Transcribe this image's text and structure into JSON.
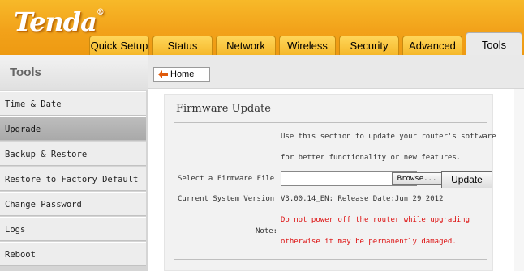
{
  "brand": {
    "logo_text": "Tenda",
    "reg_mark": "®"
  },
  "tabs": [
    {
      "label": "Quick Setup"
    },
    {
      "label": "Status"
    },
    {
      "label": "Network"
    },
    {
      "label": "Wireless"
    },
    {
      "label": "Security"
    },
    {
      "label": "Advanced"
    },
    {
      "label": "Tools",
      "active": true
    }
  ],
  "sidebar": {
    "title": "Tools",
    "items": [
      {
        "label": "Time & Date"
      },
      {
        "label": "Upgrade",
        "active": true
      },
      {
        "label": "Backup & Restore"
      },
      {
        "label": "Restore to Factory Default"
      },
      {
        "label": "Change Password"
      },
      {
        "label": "Logs"
      },
      {
        "label": "Reboot"
      }
    ]
  },
  "breadcrumb": {
    "home_label": "Home",
    "icon": "home-arrow-icon"
  },
  "firmware": {
    "title": "Firmware Update",
    "intro_line1": "Use this section to update your router's software",
    "intro_line2": "for better functionality or new features.",
    "select_label": "Select a Firmware File",
    "file_value": "",
    "browse_label": "Browse...",
    "update_label": "Update",
    "version_label": "Current System Version",
    "version_value": "V3.00.14_EN; Release Date:Jun 29 2012",
    "note_label": "Note:",
    "note_line1": "Do not power off the router while upgrading",
    "note_line2": "otherwise it may be permanently damaged."
  },
  "colors": {
    "header_orange": "#f2a21a",
    "warning_red": "#dd1111",
    "sidebar_active": "#b3b3b3"
  }
}
